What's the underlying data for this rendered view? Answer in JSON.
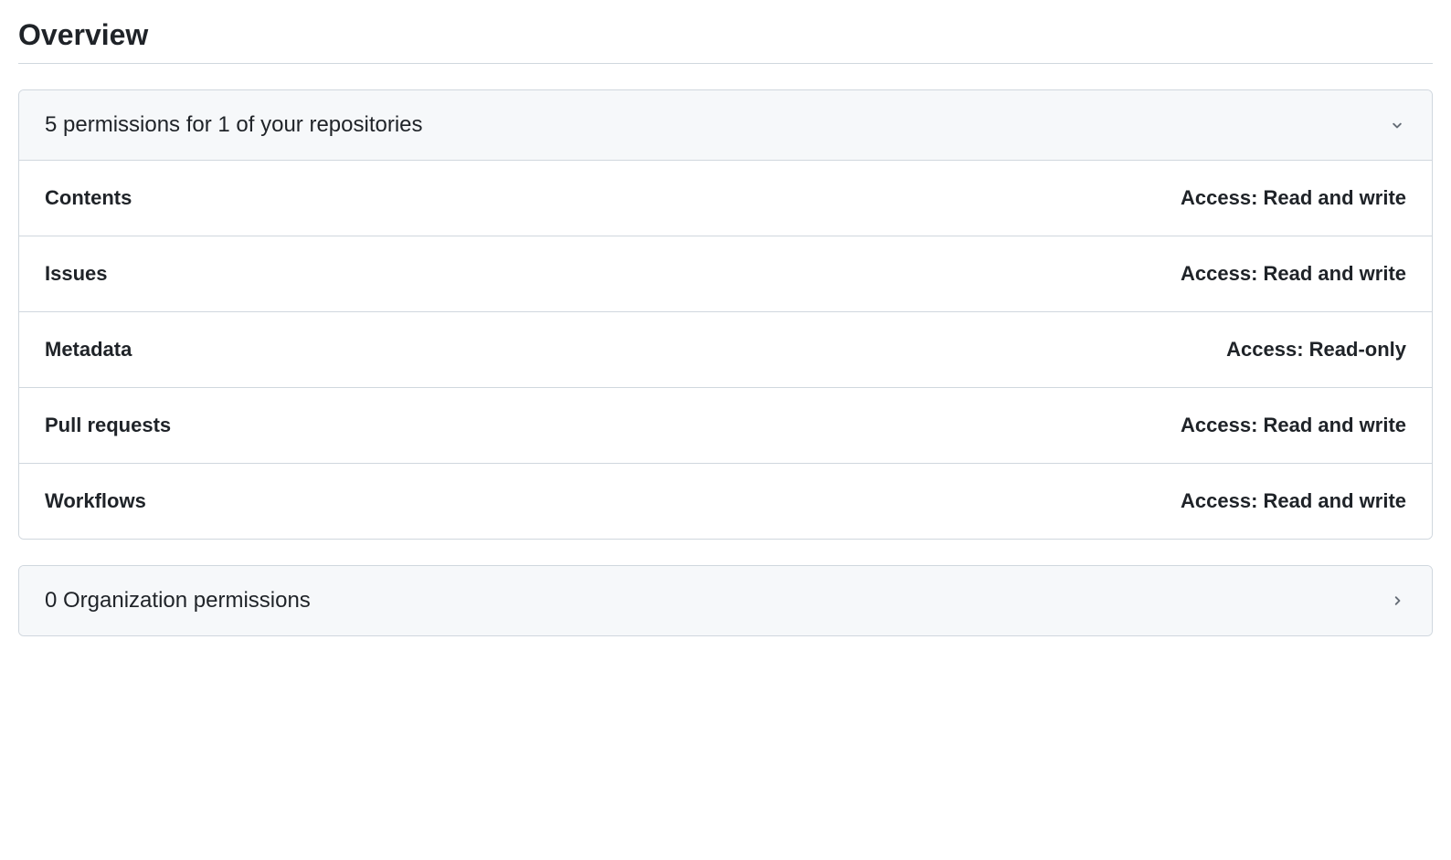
{
  "title": "Overview",
  "repository_permissions": {
    "header": "5 permissions for 1 of your repositories",
    "items": [
      {
        "name": "Contents",
        "access": "Access: Read and write"
      },
      {
        "name": "Issues",
        "access": "Access: Read and write"
      },
      {
        "name": "Metadata",
        "access": "Access: Read-only"
      },
      {
        "name": "Pull requests",
        "access": "Access: Read and write"
      },
      {
        "name": "Workflows",
        "access": "Access: Read and write"
      }
    ]
  },
  "organization_permissions": {
    "header": "0 Organization permissions"
  }
}
